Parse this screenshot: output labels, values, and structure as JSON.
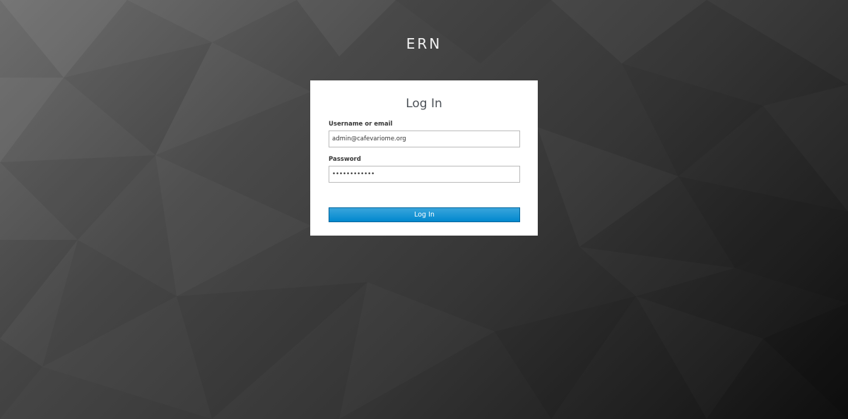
{
  "realm": {
    "title": "ERN"
  },
  "login": {
    "heading": "Log In",
    "username_label": "Username or email",
    "username_value": "admin@cafevariome.org",
    "password_label": "Password",
    "password_value": "admin-secret",
    "submit_label": "Log In"
  },
  "colors": {
    "card_background": "#ffffff",
    "button_primary": "#0088ce",
    "button_border": "#00659c",
    "heading_text": "#4d5258"
  }
}
